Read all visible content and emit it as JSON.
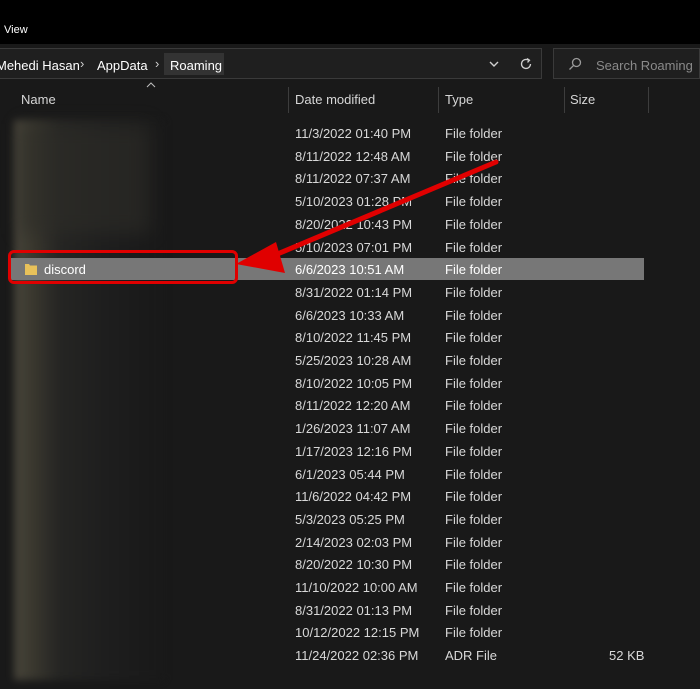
{
  "menu": {
    "view_label": "View"
  },
  "address_bar": {
    "crumbs": [
      "Mehedi Hasan",
      "AppData",
      "Roaming"
    ],
    "search_placeholder": "Search Roaming"
  },
  "columns": {
    "name": "Name",
    "date": "Date modified",
    "type": "Type",
    "size": "Size"
  },
  "selected_item": {
    "name": "discord"
  },
  "files": [
    {
      "date": "11/3/2022 01:40 PM",
      "type": "File folder",
      "size": ""
    },
    {
      "date": "8/11/2022 12:48 AM",
      "type": "File folder",
      "size": ""
    },
    {
      "date": "8/11/2022 07:37 AM",
      "type": "File folder",
      "size": ""
    },
    {
      "date": "5/10/2023 01:28 PM",
      "type": "File folder",
      "size": ""
    },
    {
      "date": "8/20/2022 10:43 PM",
      "type": "File folder",
      "size": ""
    },
    {
      "date": "5/10/2023 07:01 PM",
      "type": "File folder",
      "size": ""
    },
    {
      "date": "6/6/2023 10:51 AM",
      "type": "File folder",
      "size": ""
    },
    {
      "date": "8/31/2022 01:14 PM",
      "type": "File folder",
      "size": ""
    },
    {
      "date": "6/6/2023 10:33 AM",
      "type": "File folder",
      "size": ""
    },
    {
      "date": "8/10/2022 11:45 PM",
      "type": "File folder",
      "size": ""
    },
    {
      "date": "5/25/2023 10:28 AM",
      "type": "File folder",
      "size": ""
    },
    {
      "date": "8/10/2022 10:05 PM",
      "type": "File folder",
      "size": ""
    },
    {
      "date": "8/11/2022 12:20 AM",
      "type": "File folder",
      "size": ""
    },
    {
      "date": "1/26/2023 11:07 AM",
      "type": "File folder",
      "size": ""
    },
    {
      "date": "1/17/2023 12:16 PM",
      "type": "File folder",
      "size": ""
    },
    {
      "date": "6/1/2023 05:44 PM",
      "type": "File folder",
      "size": ""
    },
    {
      "date": "11/6/2022 04:42 PM",
      "type": "File folder",
      "size": ""
    },
    {
      "date": "5/3/2023 05:25 PM",
      "type": "File folder",
      "size": ""
    },
    {
      "date": "2/14/2023 02:03 PM",
      "type": "File folder",
      "size": ""
    },
    {
      "date": "8/20/2022 10:30 PM",
      "type": "File folder",
      "size": ""
    },
    {
      "date": "11/10/2022 10:00 AM",
      "type": "File folder",
      "size": ""
    },
    {
      "date": "8/31/2022 01:13 PM",
      "type": "File folder",
      "size": ""
    },
    {
      "date": "10/12/2022 12:15 PM",
      "type": "File folder",
      "size": ""
    },
    {
      "date": "11/24/2022 02:36 PM",
      "type": "ADR File",
      "size": "52 KB"
    }
  ],
  "colors": {
    "annotation": "#e00000",
    "selection": "#777777",
    "folder": "#e8c15a"
  }
}
